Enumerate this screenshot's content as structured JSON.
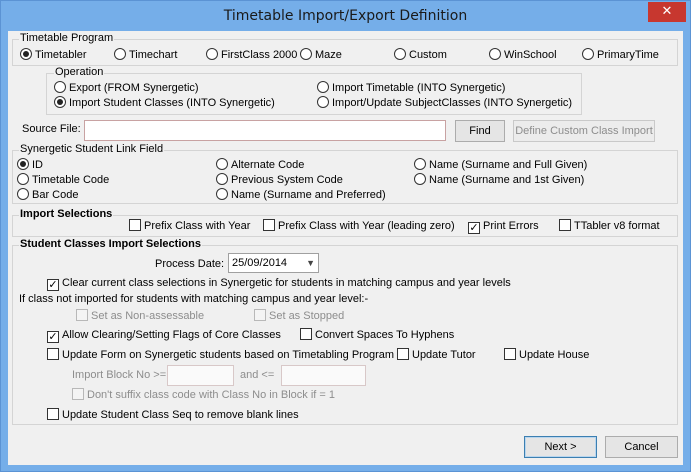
{
  "window": {
    "title": "Timetable Import/Export Definition",
    "close_glyph": "✕"
  },
  "timetable_program": {
    "label": "Timetable Program",
    "options": [
      "Timetabler",
      "Timechart",
      "FirstClass 2000",
      "Maze",
      "Custom",
      "WinSchool",
      "PrimaryTime"
    ],
    "selected": "Timetabler"
  },
  "operation": {
    "label": "Operation",
    "options": [
      "Export (FROM Synergetic)",
      "Import Timetable (INTO Synergetic)",
      "Import Student Classes (INTO Synergetic)",
      "Import/Update SubjectClasses (INTO Synergetic)"
    ],
    "selected": "Import Student Classes (INTO Synergetic)"
  },
  "source_file": {
    "label": "Source File:",
    "value": "",
    "find_label": "Find",
    "custom_label": "Define Custom Class Import"
  },
  "link_field": {
    "label": "Synergetic Student Link Field",
    "options": [
      "ID",
      "Timetable Code",
      "Bar Code",
      "Alternate Code",
      "Previous System Code",
      "Name (Surname and Preferred)",
      "Name (Surname and Full Given)",
      "Name (Surname and 1st Given)"
    ],
    "selected": "ID"
  },
  "import_selections": {
    "label": "Import Selections",
    "prefix_class_with_year": {
      "label": "Prefix Class with Year",
      "checked": false
    },
    "prefix_class_leading_zero": {
      "label": "Prefix Class with Year (leading zero)",
      "checked": false
    },
    "print_errors": {
      "label": "Print Errors",
      "checked": true
    },
    "ttabler_v8": {
      "label": "TTabler v8 format",
      "checked": false
    }
  },
  "student_classes": {
    "label": "Student Classes Import Selections",
    "process_date_label": "Process Date:",
    "process_date": "25/09/2014",
    "clear_current": {
      "label": "Clear current class selections in Synergetic for students in matching campus and year levels",
      "checked": true
    },
    "not_imported_label": "If class not imported for students with matching campus and year level:-",
    "set_non_assessable": {
      "label": "Set as Non-assessable",
      "checked": false
    },
    "set_stopped": {
      "label": "Set as Stopped",
      "checked": false
    },
    "allow_clearing": {
      "label": "Allow Clearing/Setting Flags of Core Classes",
      "checked": true
    },
    "convert_spaces": {
      "label": "Convert Spaces To Hyphens",
      "checked": false
    },
    "update_form": {
      "label": "Update Form on Synergetic students based on Timetabling Program",
      "checked": false
    },
    "update_tutor": {
      "label": "Update Tutor",
      "checked": false
    },
    "update_house": {
      "label": "Update House",
      "checked": false
    },
    "import_block_label": "Import Block No >=",
    "import_block_and_label": "and <=",
    "dont_suffix": {
      "label": "Don't suffix class code with Class No in Block if = 1",
      "checked": false
    },
    "update_seq": {
      "label": "Update Student Class Seq to remove blank lines",
      "checked": false
    }
  },
  "footer": {
    "next_label": "Next >",
    "cancel_label": "Cancel"
  }
}
